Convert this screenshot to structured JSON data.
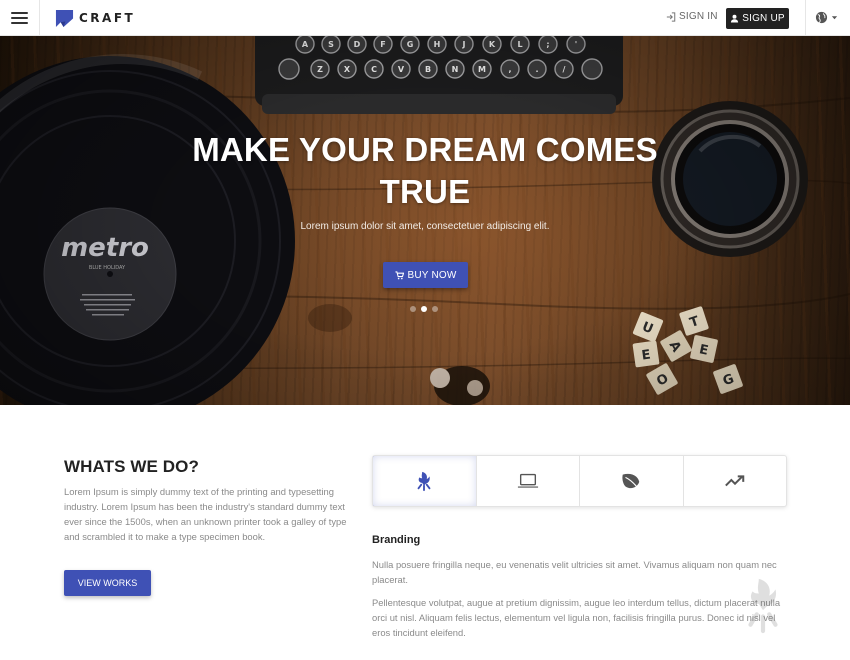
{
  "header": {
    "logo_text": "CRAFT",
    "signin_label": "SIGN IN",
    "signup_label": "SIGN UP",
    "icons": [
      "menu-icon",
      "craft-logo-icon",
      "login-icon",
      "user-icon",
      "globe-icon",
      "caret-down-icon"
    ]
  },
  "hero": {
    "title": "MAKE YOUR DREAM COMES TRUE",
    "subtitle": "Lorem ipsum dolor sit amet, consectetuer adipiscing elit.",
    "buy_label": "BUY NOW",
    "slides": 3,
    "active_slide": 2,
    "record_label": "metro",
    "record_sublabel": "BLUE HOLIDAY",
    "scrabble_tiles": [
      "U",
      "E",
      "A",
      "E",
      "O"
    ]
  },
  "whatwedo": {
    "title": "WHATS WE DO?",
    "text": "Lorem Ipsum is simply dummy text of the printing and typesetting industry. Lorem Ipsum has been the industry's standard dummy text ever since the 1500s, when an unknown printer took a galley of type and scrambled it to make a type specimen book.",
    "button_label": "VIEW WORKS"
  },
  "services": {
    "tabs": [
      {
        "icon": "branding-icon",
        "active": true
      },
      {
        "icon": "laptop-icon",
        "active": false
      },
      {
        "icon": "leaf-icon",
        "active": false
      },
      {
        "icon": "trending-up-icon",
        "active": false
      }
    ],
    "active_title": "Branding",
    "paragraph1": "Nulla posuere fringilla neque, eu venenatis velit ultricies sit amet. Vivamus aliquam non quam nec placerat.",
    "paragraph2": "Pellentesque volutpat, augue at pretium dignissim, augue leo interdum tellus, dictum placerat nulla orci ut nisl. Aliquam felis lectus, elementum vel ligula non, facilisis fringilla purus. Donec id nisl vel eros tincidunt eleifend."
  },
  "colors": {
    "primary": "#3f51b5",
    "dark": "#222222",
    "muted_text": "#8a8a8a"
  }
}
